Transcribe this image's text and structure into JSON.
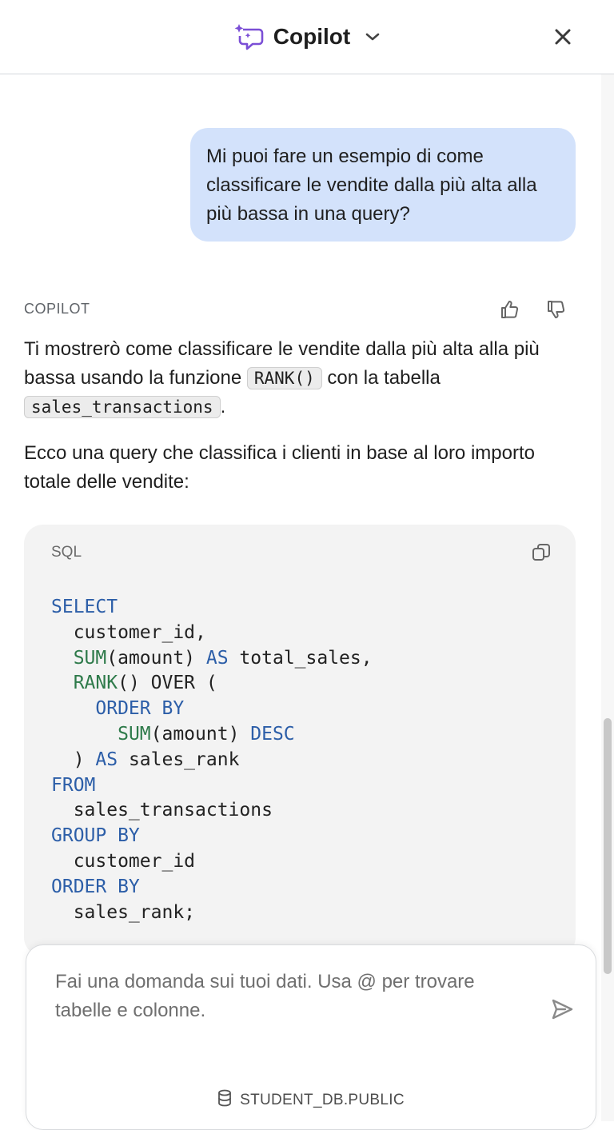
{
  "header": {
    "title": "Copilot",
    "logo_icon": "copilot-chat-sparkle-icon",
    "accent_color": "#7b4fd6"
  },
  "conversation": {
    "user_message": "Mi puoi fare un esempio di come classificare le vendite dalla più alta alla più bassa in una query?",
    "assistant_label": "COPILOT",
    "para1_prefix": "Ti mostrerò come classificare le vendite dalla più alta alla più bassa usando la funzione ",
    "para1_code1": "RANK()",
    "para1_middle": " con la tabella ",
    "para1_code2": "sales_transactions",
    "para1_suffix": ".",
    "para2": "Ecco una query che classifica i clienti in base al loro importo totale delle vendite:"
  },
  "code_block": {
    "language": "SQL",
    "lines": [
      [
        {
          "t": "SELECT",
          "c": "kw"
        }
      ],
      [
        {
          "t": "  customer_id,",
          "c": ""
        }
      ],
      [
        {
          "t": "  ",
          "c": ""
        },
        {
          "t": "SUM",
          "c": "fn"
        },
        {
          "t": "(amount) ",
          "c": ""
        },
        {
          "t": "AS",
          "c": "kw"
        },
        {
          "t": " total_sales,",
          "c": ""
        }
      ],
      [
        {
          "t": "  ",
          "c": ""
        },
        {
          "t": "RANK",
          "c": "fn"
        },
        {
          "t": "() OVER (",
          "c": ""
        }
      ],
      [
        {
          "t": "    ",
          "c": ""
        },
        {
          "t": "ORDER BY",
          "c": "kw"
        }
      ],
      [
        {
          "t": "      ",
          "c": ""
        },
        {
          "t": "SUM",
          "c": "fn"
        },
        {
          "t": "(amount) ",
          "c": ""
        },
        {
          "t": "DESC",
          "c": "kw"
        }
      ],
      [
        {
          "t": "  ) ",
          "c": ""
        },
        {
          "t": "AS",
          "c": "kw"
        },
        {
          "t": " sales_rank",
          "c": ""
        }
      ],
      [
        {
          "t": "FROM",
          "c": "kw"
        }
      ],
      [
        {
          "t": "  sales_transactions",
          "c": ""
        }
      ],
      [
        {
          "t": "GROUP BY",
          "c": "kw"
        }
      ],
      [
        {
          "t": "  customer_id",
          "c": ""
        }
      ],
      [
        {
          "t": "ORDER BY",
          "c": "kw"
        }
      ],
      [
        {
          "t": "  sales_rank;",
          "c": ""
        }
      ]
    ],
    "keyword_color": "#2c5ea8",
    "function_color": "#2e7a4a"
  },
  "composer": {
    "placeholder": "Fai una domanda sui tuoi dati. Usa @ per trovare tabelle e colonne.",
    "database": "STUDENT_DB.PUBLIC"
  },
  "icons": {
    "close": "close-icon",
    "chevron": "chevron-down-icon",
    "thumbs_up": "thumbs-up-icon",
    "thumbs_down": "thumbs-down-icon",
    "copy": "copy-icon",
    "send": "send-icon",
    "database": "database-icon"
  },
  "colors": {
    "user_bubble": "#d3e2fb",
    "code_background": "#f3f3f3"
  }
}
